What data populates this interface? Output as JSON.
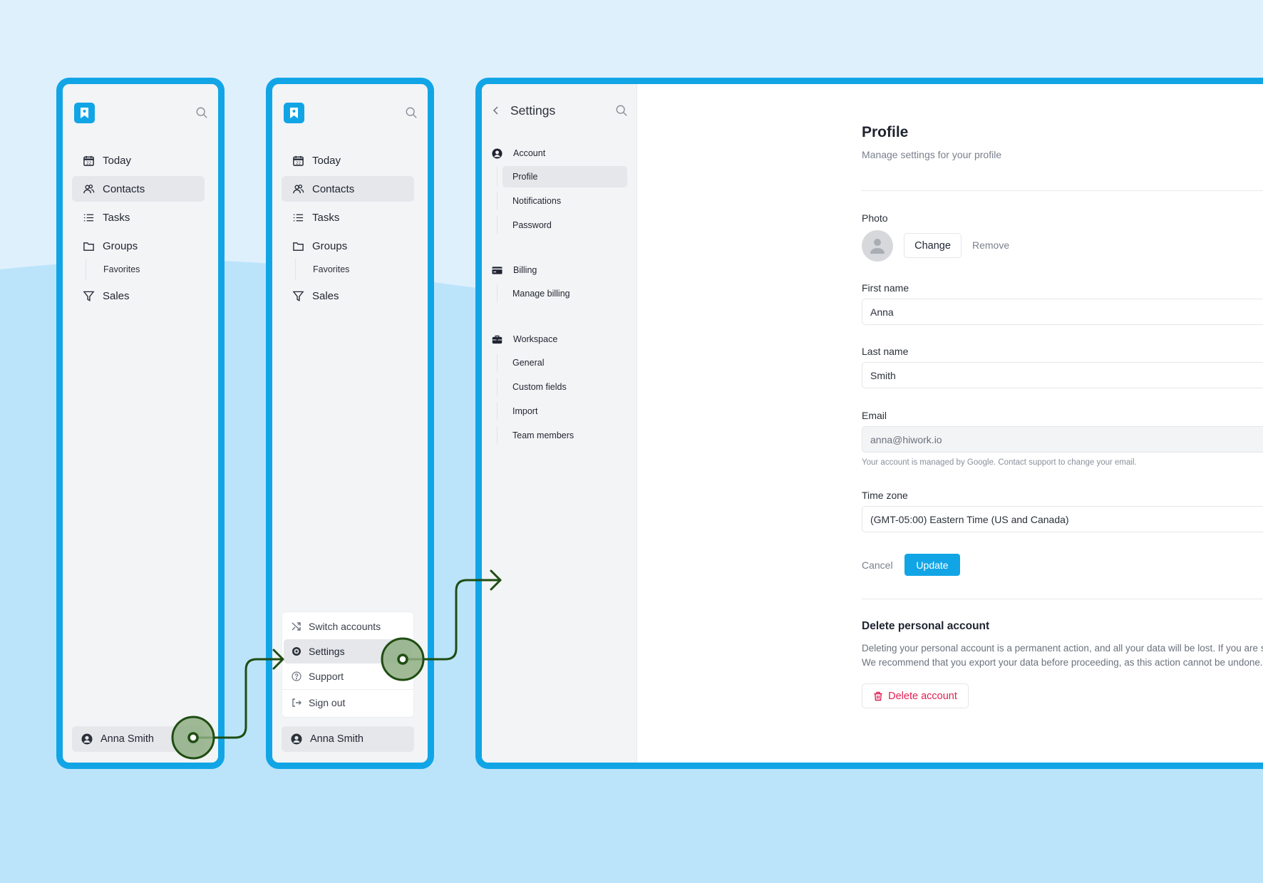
{
  "colors": {
    "accent": "#12a5e6",
    "danger": "#df1f55",
    "flow": "#1f4d12",
    "click_marker": "#8fae84"
  },
  "sidebar": {
    "logo_icon": "bookmark-logo-icon",
    "search_icon": "search-icon",
    "items": [
      {
        "label": "Today",
        "icon": "calendar-icon"
      },
      {
        "label": "Contacts",
        "icon": "users-icon",
        "active": true
      },
      {
        "label": "Tasks",
        "icon": "list-icon"
      },
      {
        "label": "Groups",
        "icon": "folder-icon"
      },
      {
        "label": "Favorites",
        "sub": true
      },
      {
        "label": "Sales",
        "icon": "filter-icon"
      }
    ],
    "user": {
      "name": "Anna Smith",
      "icon": "user-circle-icon"
    }
  },
  "user_menu": {
    "items": [
      {
        "label": "Switch accounts",
        "icon": "shuffle-icon"
      },
      {
        "label": "Settings",
        "icon": "gear-icon",
        "active": true
      },
      {
        "label": "Support",
        "icon": "help-icon"
      },
      {
        "label": "Sign out",
        "icon": "sign-out-icon"
      }
    ]
  },
  "settings": {
    "title": "Settings",
    "back_icon": "chevron-left-icon",
    "groups": [
      {
        "label": "Account",
        "icon": "user-circle-icon",
        "items": [
          "Profile",
          "Notifications",
          "Password"
        ]
      },
      {
        "label": "Billing",
        "icon": "credit-card-icon",
        "items": [
          "Manage billing"
        ]
      },
      {
        "label": "Workspace",
        "icon": "briefcase-icon",
        "items": [
          "General",
          "Custom fields",
          "Import",
          "Team members"
        ]
      }
    ],
    "active_item": "Profile"
  },
  "profile": {
    "title": "Profile",
    "subtitle": "Manage settings for your profile",
    "photo_label": "Photo",
    "change_label": "Change",
    "remove_label": "Remove",
    "first_name_label": "First name",
    "first_name_value": "Anna",
    "last_name_label": "Last name",
    "last_name_value": "Smith",
    "email_label": "Email",
    "email_value": "anna@hiwork.io",
    "email_hint": "Your account is managed by Google. Contact support to change your email.",
    "timezone_label": "Time zone",
    "timezone_value": "(GMT-05:00) Eastern Time (US and Canada)",
    "cancel_label": "Cancel",
    "update_label": "Update",
    "delete_title": "Delete personal account",
    "delete_text": "Deleting your personal account is a permanent action, and all your data will be lost. If you are sure you want to proceed, please click the button below. We recommend that you export your data before proceeding, as this action cannot be undone.",
    "delete_button": "Delete account"
  }
}
